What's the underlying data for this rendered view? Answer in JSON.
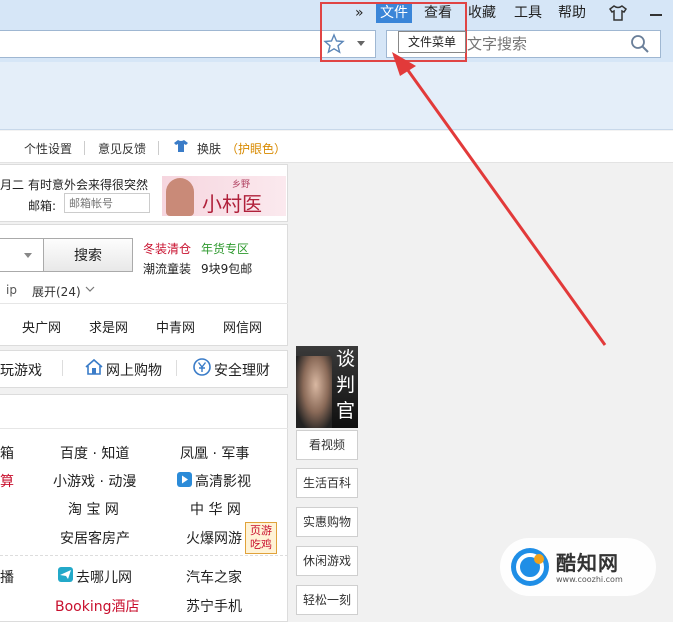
{
  "menu": {
    "chevron": "»",
    "file": "文件",
    "view": "查看",
    "favorites": "收藏",
    "tools": "工具",
    "help": "帮助"
  },
  "search": {
    "placeholder": "文字搜索"
  },
  "tooltip": "文件菜单",
  "settings": {
    "personal": "个性设置",
    "feedback": "意见反馈",
    "skin": "换肤",
    "eye": "（护眼色）"
  },
  "notice": {
    "frag": "月二",
    "text": "有时意外会来得很突然",
    "email_label": "邮箱:",
    "email_placeholder": "邮箱帐号"
  },
  "banner": {
    "top": "乡野",
    "text": "小村医"
  },
  "searchform": {
    "button": "搜索",
    "links": [
      {
        "text": "冬装清仓",
        "color": "red"
      },
      {
        "text": "年货专区",
        "color": "green"
      },
      {
        "text": "潮流童装",
        "color": "dark"
      },
      {
        "text": "9块9包邮",
        "color": "dark"
      }
    ],
    "ip": "ip",
    "expand": "展开(24)"
  },
  "news": [
    "央广网",
    "求是网",
    "中青网",
    "网信网"
  ],
  "categories": [
    "玩游戏",
    "网上购物",
    "安全理财"
  ],
  "ad": {
    "title": "谈判官"
  },
  "sites": [
    [
      "箱",
      "百度 · 知道",
      "凤凰 · 军事"
    ],
    [
      "算",
      "小游戏 · 动漫",
      "高清影视"
    ],
    [
      "",
      "淘 宝 网",
      "中 华 网"
    ],
    [
      "",
      "安居客房产",
      "火爆网游"
    ],
    [
      "播",
      "去哪儿网",
      "汽车之家"
    ],
    [
      "",
      "Booking酒店",
      "苏宁手机"
    ]
  ],
  "badge": {
    "line1": "页游",
    "line2": "吃鸡"
  },
  "side": [
    "看视频",
    "生活百科",
    "实惠购物",
    "休闲游戏",
    "轻松一刻"
  ],
  "watermark": {
    "name": "酷知网",
    "url": "www.coozhi.com"
  }
}
